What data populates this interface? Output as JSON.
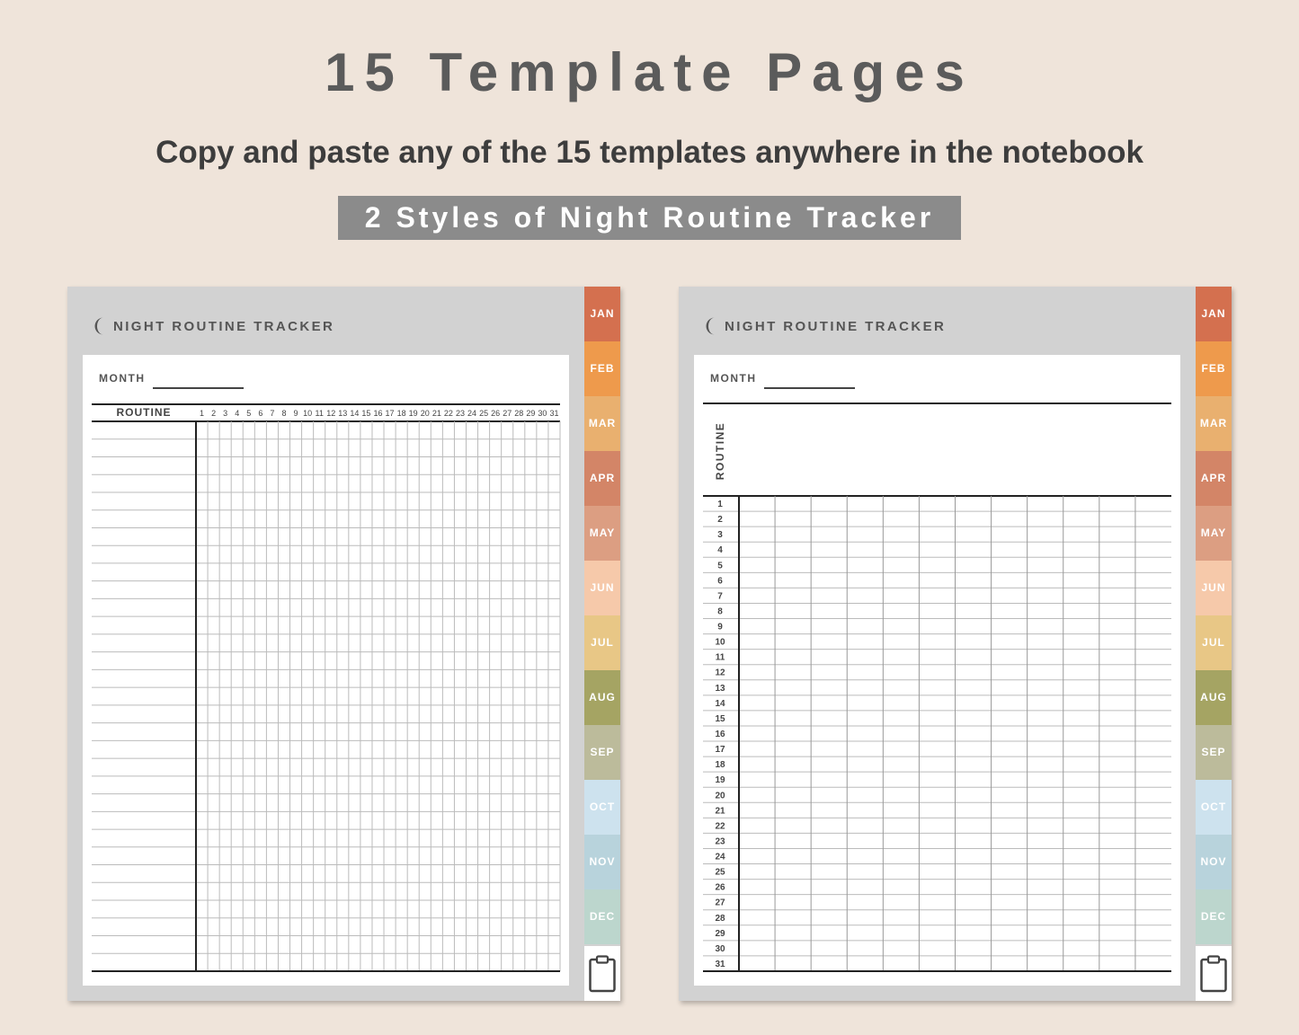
{
  "heading": {
    "title": "15 Template Pages",
    "subtitle": "Copy and paste any of the 15 templates anywhere in the notebook",
    "banner": "2 Styles of Night Routine Tracker"
  },
  "tracker": {
    "title": "NIGHT ROUTINE TRACKER",
    "month_label": "MONTH",
    "routine_label": "ROUTINE",
    "day_numbers": [
      "1",
      "2",
      "3",
      "4",
      "5",
      "6",
      "7",
      "8",
      "9",
      "10",
      "11",
      "12",
      "13",
      "14",
      "15",
      "16",
      "17",
      "18",
      "19",
      "20",
      "21",
      "22",
      "23",
      "24",
      "25",
      "26",
      "27",
      "28",
      "29",
      "30",
      "31"
    ]
  },
  "tabs": [
    {
      "label": "JAN",
      "color": "#d4704f"
    },
    {
      "label": "FEB",
      "color": "#ee9a4c"
    },
    {
      "label": "MAR",
      "color": "#e9b06f"
    },
    {
      "label": "APR",
      "color": "#d38567"
    },
    {
      "label": "MAY",
      "color": "#dc9e82"
    },
    {
      "label": "JUN",
      "color": "#f6c9aa"
    },
    {
      "label": "JUL",
      "color": "#e8c786"
    },
    {
      "label": "AUG",
      "color": "#a5a463"
    },
    {
      "label": "SEP",
      "color": "#bcbb9b"
    },
    {
      "label": "OCT",
      "color": "#cde2ee"
    },
    {
      "label": "NOV",
      "color": "#b8d3dc"
    },
    {
      "label": "DEC",
      "color": "#bcd6cd"
    }
  ],
  "icons": {
    "moon": "moon-icon",
    "clipboard": "clipboard-icon"
  }
}
